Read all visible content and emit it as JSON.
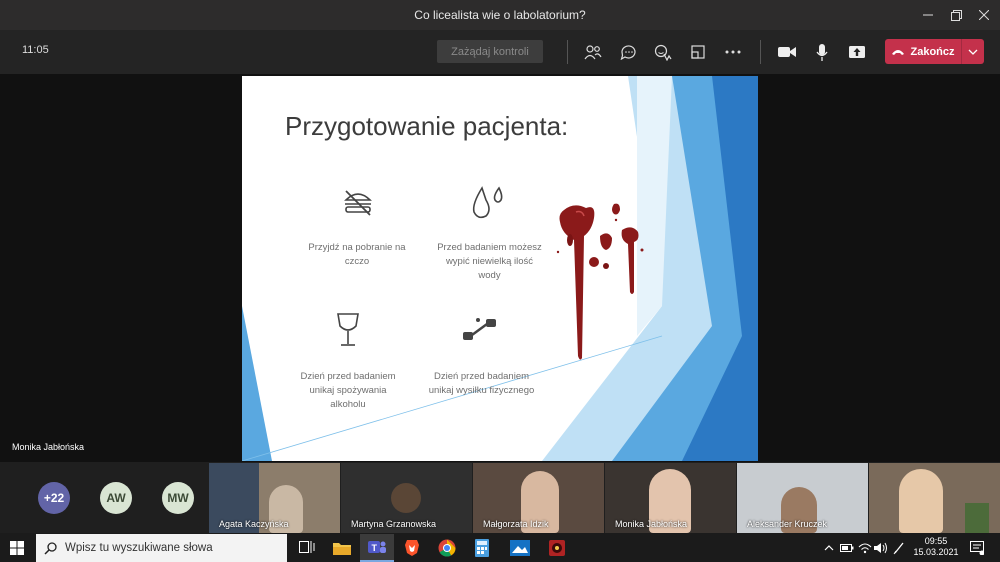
{
  "window": {
    "title": "Co licealista wie o labolatorium?"
  },
  "toolbar": {
    "time": "11:05",
    "request_control_label": "Zażądaj kontroli",
    "end_call_label": "Zakończ",
    "icons": [
      "participants-icon",
      "chat-icon",
      "reactions-icon",
      "rooms-icon",
      "more-icon",
      "camera-icon",
      "mic-icon",
      "share-icon"
    ]
  },
  "slide": {
    "title": "Przygotowanie pacjenta:",
    "items": [
      {
        "icon": "no-food-icon",
        "text_line1": "Przyjdź na pobranie na",
        "text_line2": "czczo",
        "text_line3": ""
      },
      {
        "icon": "water-drops-icon",
        "text_line1": "Przed badaniem możesz",
        "text_line2": "wypić niewielką ilość",
        "text_line3": "wody"
      },
      {
        "icon": "wine-glass-icon",
        "text_line1": "Dzień przed badaniem",
        "text_line2": "unikaj spożywania",
        "text_line3": "alkoholu"
      },
      {
        "icon": "dumbbell-icon",
        "text_line1": "Dzień przed badaniem",
        "text_line2": "unikaj wysiłku fizycznego",
        "text_line3": ""
      }
    ]
  },
  "presenter_name": "Monika Jabłońska",
  "participants": {
    "overflow": "+22",
    "avatars": [
      {
        "initials": "AW",
        "color": "#d9e5d3"
      },
      {
        "initials": "MW",
        "color": "#d9e5d3"
      }
    ],
    "tiles": [
      {
        "name": "Agata Kaczyńska"
      },
      {
        "name": "Martyna Grzanowska"
      },
      {
        "name": "Małgorzata Idzik"
      },
      {
        "name": "Monika Jabłońska"
      },
      {
        "name": "Aleksander Kruczek"
      },
      {
        "name": ""
      }
    ]
  },
  "taskbar": {
    "search_placeholder": "Wpisz tu wyszukiwane słowa",
    "time": "09:55",
    "date": "15.03.2021"
  },
  "colors": {
    "accent_end": "#c4314b",
    "overflow_bubble": "#6264a7",
    "avatar_bubble": "#d9e5d3"
  }
}
